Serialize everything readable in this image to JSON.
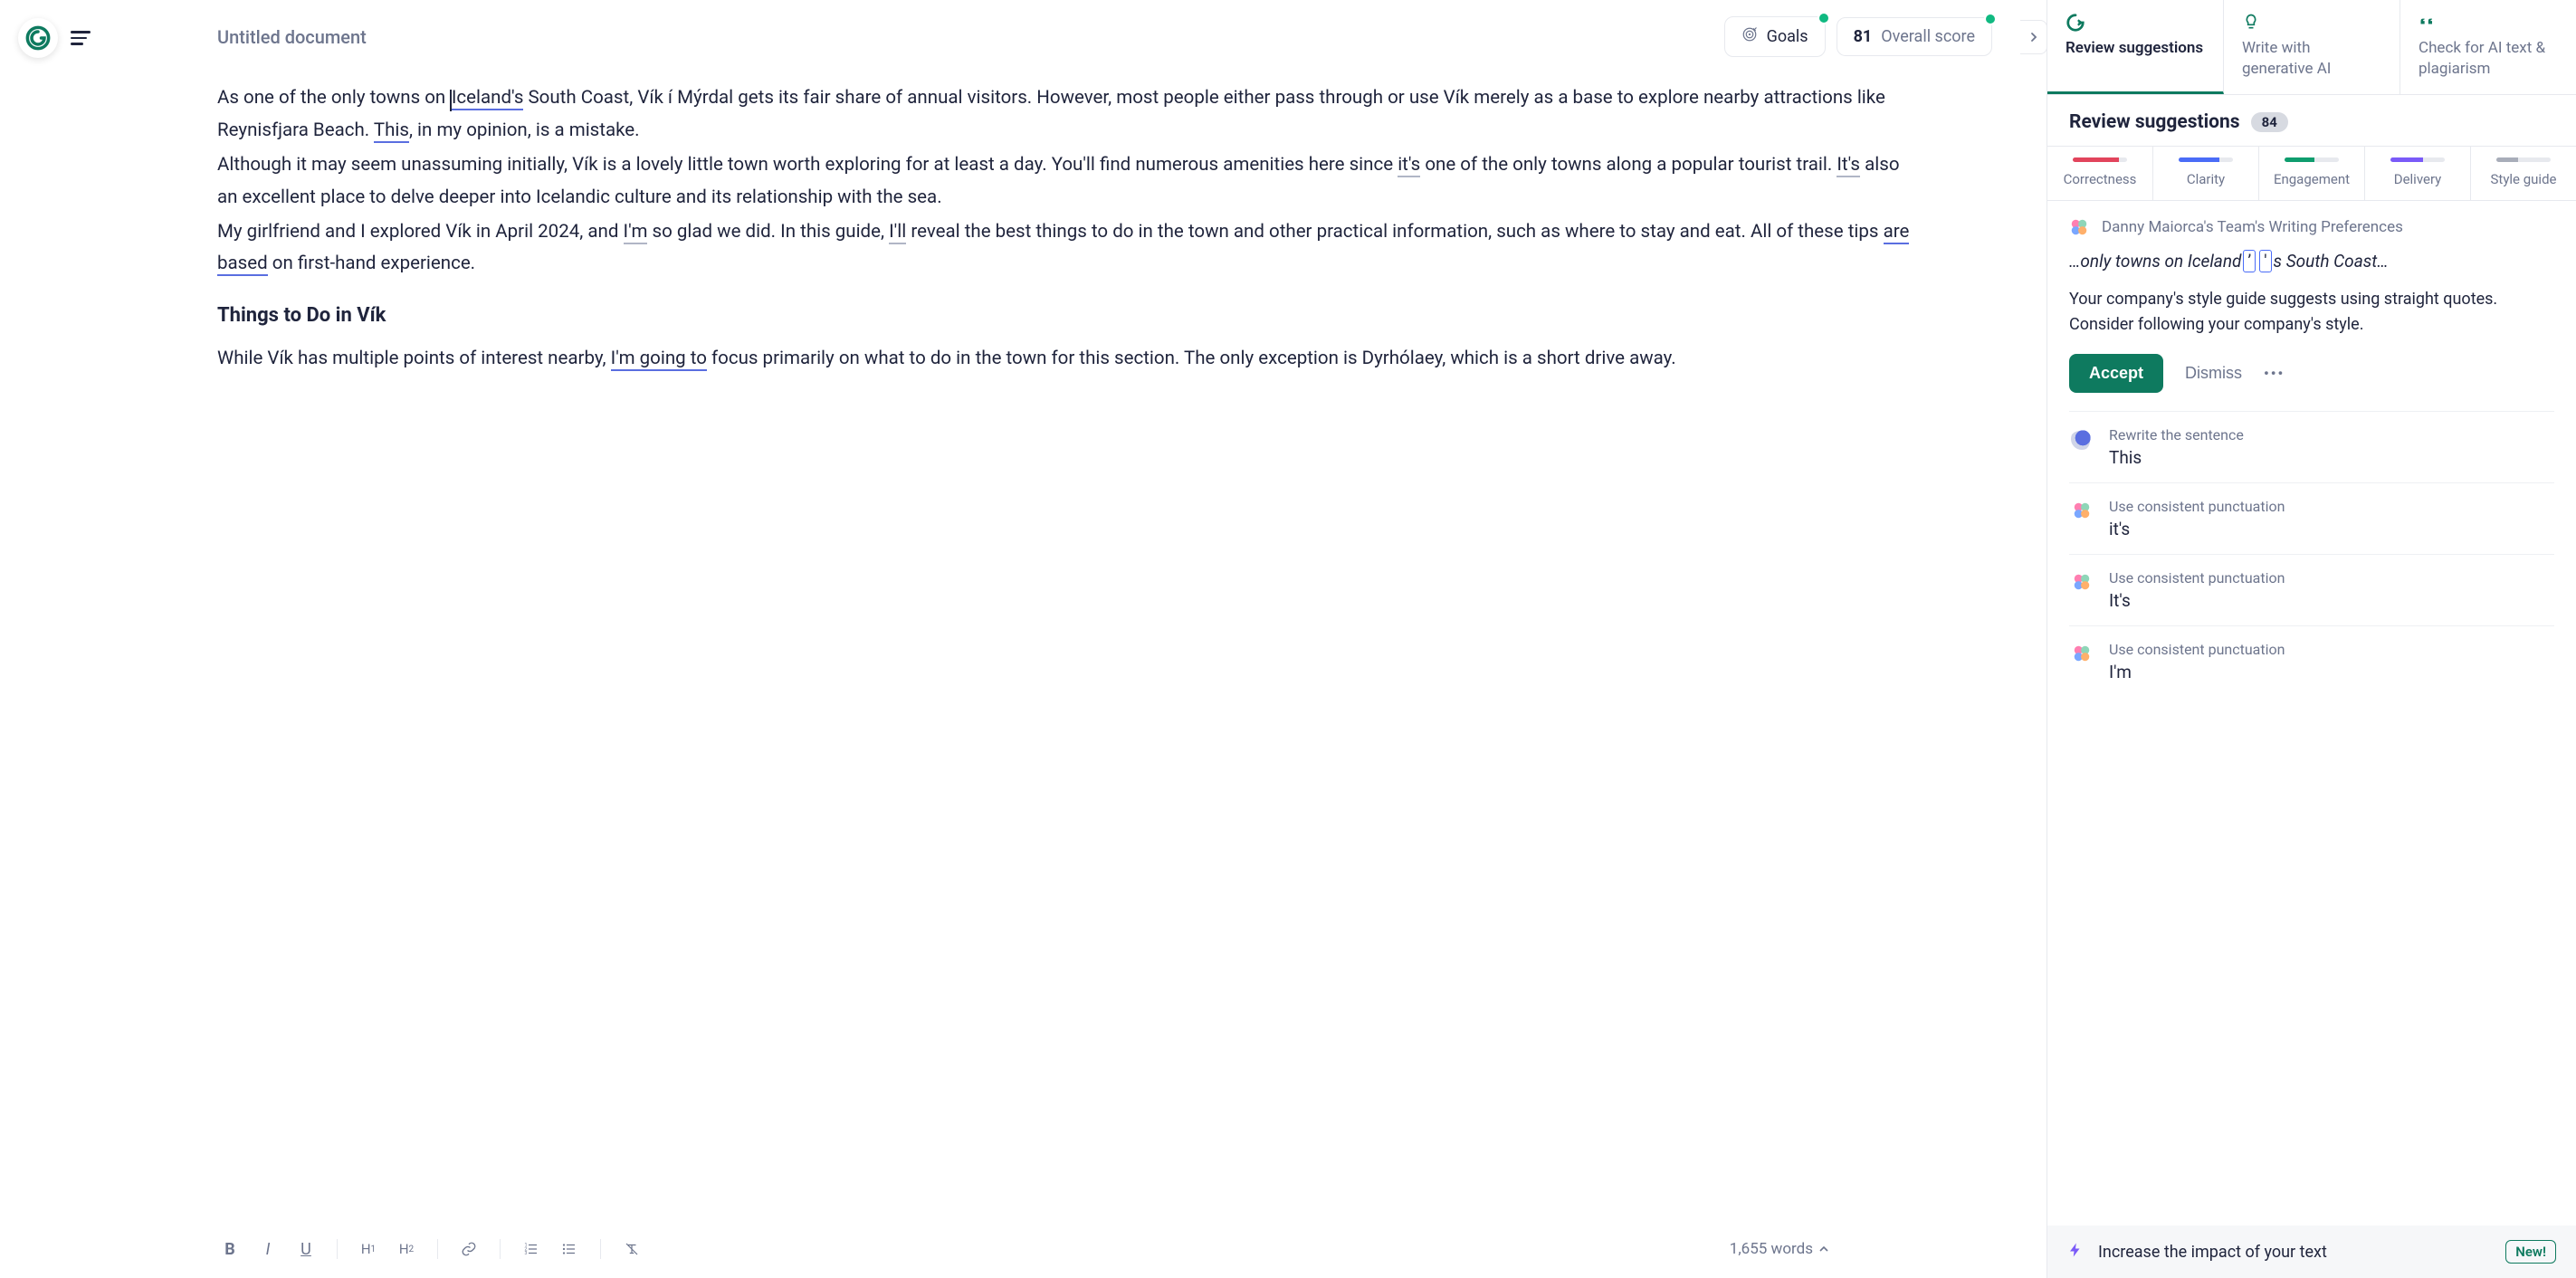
{
  "header": {
    "doc_title": "Untitled document",
    "goals_label": "Goals",
    "score_value": "81",
    "score_label": "Overall score"
  },
  "document": {
    "p1_a": "As one of the only towns on ",
    "p1_iceland": "Iceland's",
    "p1_b": " South Coast, Vík í Mýrdal gets its fair share of annual visitors. However, most people either pass through or use Vík merely as a base to explore nearby attractions like Reynisfjara Beach. ",
    "p1_this": "This",
    "p1_c": ", in my opinion, is a mistake.",
    "p2_a": "Although it may seem unassuming initially, Vík is a lovely little town worth exploring for at least a day. You'll find numerous amenities here since ",
    "p2_its1": "it's",
    "p2_b": " one of the only towns along a popular tourist trail. ",
    "p2_its2": "It's",
    "p2_c": " also an excellent place to delve deeper into Icelandic culture and its relationship with the sea.",
    "p3_a": "My girlfriend and I explored Vík in April 2024, and ",
    "p3_im": "I'm",
    "p3_b": " so glad we did. In this guide, ",
    "p3_ill": "I'll",
    "p3_c": " reveal the best things to do in the town and other practical information, such as where to stay and eat. All of these tips ",
    "p3_based": "are based",
    "p3_d": " on first-hand experience.",
    "h2": "Things to Do in Vík",
    "p4_a": "While Vík has multiple points of interest nearby, ",
    "p4_going": "I'm going to",
    "p4_b": " focus primarily on what to do in the town for this section. The only exception is Dyrhólaey, which is a short drive away."
  },
  "bottom": {
    "word_count": "1,655 words"
  },
  "sidebar": {
    "tabs": {
      "review": "Review suggestions",
      "write": "Write with generative AI",
      "check": "Check for AI text & plagiarism"
    },
    "panel_title": "Review suggestions",
    "count": "84",
    "categories": {
      "correctness": "Correctness",
      "clarity": "Clarity",
      "engagement": "Engagement",
      "delivery": "Delivery",
      "style": "Style guide"
    },
    "featured": {
      "source": "Danny Maiorca's Team's Writing Preferences",
      "preview_a": "…only towns on Iceland",
      "preview_box": "'",
      "preview_b": "s South Coast…",
      "body": "Your company's style guide suggests using straight quotes. Consider following your company's style.",
      "accept": "Accept",
      "dismiss": "Dismiss"
    },
    "rows": [
      {
        "type": "Rewrite the sentence",
        "word": "This",
        "icon": "blue"
      },
      {
        "type": "Use consistent punctuation",
        "word": "it's",
        "icon": "flower"
      },
      {
        "type": "Use consistent punctuation",
        "word": "It's",
        "icon": "flower"
      },
      {
        "type": "Use consistent punctuation",
        "word": "I'm",
        "icon": "flower"
      }
    ],
    "footer": {
      "text": "Increase the impact of your text",
      "badge": "New!"
    }
  }
}
